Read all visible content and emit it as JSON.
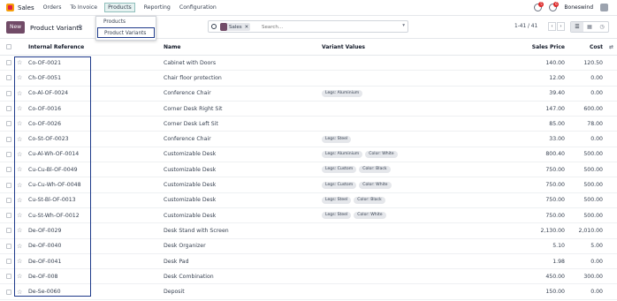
{
  "app": {
    "name": "Sales",
    "menu": [
      "Orders",
      "To Invoice",
      "Products",
      "Reporting",
      "Configuration"
    ],
    "active_menu": "Products"
  },
  "topright": {
    "badge1": "5",
    "badge2": "6",
    "company": "Boneswind"
  },
  "controls": {
    "new_label": "New",
    "title": "Product Variants",
    "gear": "✿",
    "pager": "1-41 / 41",
    "prev": "‹",
    "next": "›"
  },
  "search": {
    "facet": "Sales",
    "facet_remove": "✕",
    "placeholder": "Search...",
    "toggle": "▾"
  },
  "views": [
    "☰",
    "▦",
    "◷"
  ],
  "dropdown": {
    "items": [
      "Products",
      "Product Variants"
    ]
  },
  "table": {
    "headers": {
      "ref": "Internal Reference",
      "name": "Name",
      "variants": "Variant Values",
      "price": "Sales Price",
      "cost": "Cost",
      "opt": "⇄"
    },
    "rows": [
      {
        "ref": "Co-OF-0021",
        "name": "Cabinet with Doors",
        "tags": [],
        "price": "140.00",
        "cost": "120.50"
      },
      {
        "ref": "Ch-OF-0051",
        "name": "Chair floor protection",
        "tags": [],
        "price": "12.00",
        "cost": "0.00"
      },
      {
        "ref": "Co-Al-OF-0024",
        "name": "Conference Chair",
        "tags": [
          "Legs: Aluminium"
        ],
        "price": "39.40",
        "cost": "0.00"
      },
      {
        "ref": "Co-OF-0016",
        "name": "Corner Desk Right Sit",
        "tags": [],
        "price": "147.00",
        "cost": "600.00"
      },
      {
        "ref": "Co-OF-0026",
        "name": "Corner Desk Left Sit",
        "tags": [],
        "price": "85.00",
        "cost": "78.00"
      },
      {
        "ref": "Co-St-OF-0023",
        "name": "Conference Chair",
        "tags": [
          "Legs: Steel"
        ],
        "price": "33.00",
        "cost": "0.00"
      },
      {
        "ref": "Cu-Al-Wh-OF-0014",
        "name": "Customizable Desk",
        "tags": [
          "Legs: Aluminium",
          "Color: White"
        ],
        "price": "800.40",
        "cost": "500.00"
      },
      {
        "ref": "Cu-Cu-Bl-OF-0049",
        "name": "Customizable Desk",
        "tags": [
          "Legs: Custom",
          "Color: Black"
        ],
        "price": "750.00",
        "cost": "500.00"
      },
      {
        "ref": "Cu-Cu-Wh-OF-0048",
        "name": "Customizable Desk",
        "tags": [
          "Legs: Custom",
          "Color: White"
        ],
        "price": "750.00",
        "cost": "500.00"
      },
      {
        "ref": "Cu-St-Bl-OF-0013",
        "name": "Customizable Desk",
        "tags": [
          "Legs: Steel",
          "Color: Black"
        ],
        "price": "750.00",
        "cost": "500.00"
      },
      {
        "ref": "Cu-St-Wh-OF-0012",
        "name": "Customizable Desk",
        "tags": [
          "Legs: Steel",
          "Color: White"
        ],
        "price": "750.00",
        "cost": "500.00"
      },
      {
        "ref": "De-OF-0029",
        "name": "Desk Stand with Screen",
        "tags": [],
        "price": "2,130.00",
        "cost": "2,010.00"
      },
      {
        "ref": "De-OF-0040",
        "name": "Desk Organizer",
        "tags": [],
        "price": "5.10",
        "cost": "5.00"
      },
      {
        "ref": "De-OF-0041",
        "name": "Desk Pad",
        "tags": [],
        "price": "1.98",
        "cost": "0.00"
      },
      {
        "ref": "De-OF-008",
        "name": "Desk Combination",
        "tags": [],
        "price": "450.00",
        "cost": "300.00"
      },
      {
        "ref": "De-Se-0060",
        "name": "Deposit",
        "tags": [],
        "price": "150.00",
        "cost": "0.00"
      }
    ]
  }
}
